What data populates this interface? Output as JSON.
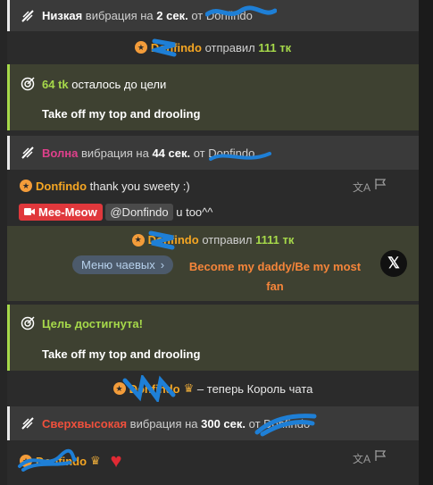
{
  "colors": {
    "accent_orange": "#f5a623",
    "goal_green": "#a6d94a",
    "wave_pink": "#e0408c",
    "ultra_red": "#f0503c",
    "mention_red": "#e0383c",
    "tip_menu_blue": "#b7d1ec"
  },
  "row1": {
    "level": "Низкая",
    "text_mid": "вибрация на",
    "duration": "2 сек.",
    "from": "от",
    "user": "Donfindo"
  },
  "tip1": {
    "user": "Donfindo",
    "action": "отправил",
    "amount": "111 тк"
  },
  "goal1": {
    "left": "64 tk",
    "left_text": "осталось до цели",
    "goal_text": "Take off my top and drooling"
  },
  "row2": {
    "level": "Волна",
    "text_mid": "вибрация на",
    "duration": "44 сек.",
    "from": "от",
    "user": "Donfindo"
  },
  "msg1": {
    "user": "Donfindo",
    "text": "thank you sweety :)",
    "translate_icon": "translate-icon",
    "report_icon": "flag-icon"
  },
  "msg2": {
    "badge": "Mee-Meow",
    "mention": "@Donfindo",
    "text": "u too^^"
  },
  "tip2": {
    "user": "Donfindo",
    "action": "отправил",
    "amount": "1111 тк",
    "menu_label": "Меню чаевых",
    "item_line1": "Become my daddy/Be my most",
    "item_line2": "fan",
    "close_icon": "x-close-icon"
  },
  "goal2": {
    "reached": "Цель достигнута!",
    "goal_text": "Take off my top and drooling"
  },
  "king": {
    "user": "Donfindo",
    "text": "– теперь Король чата"
  },
  "row3": {
    "level": "Сверхвысокая",
    "text_mid": "вибрация на",
    "duration": "300 сек.",
    "from": "от",
    "user": "Donfindo"
  },
  "msg3": {
    "user": "Donfindo",
    "heart": "♥"
  }
}
